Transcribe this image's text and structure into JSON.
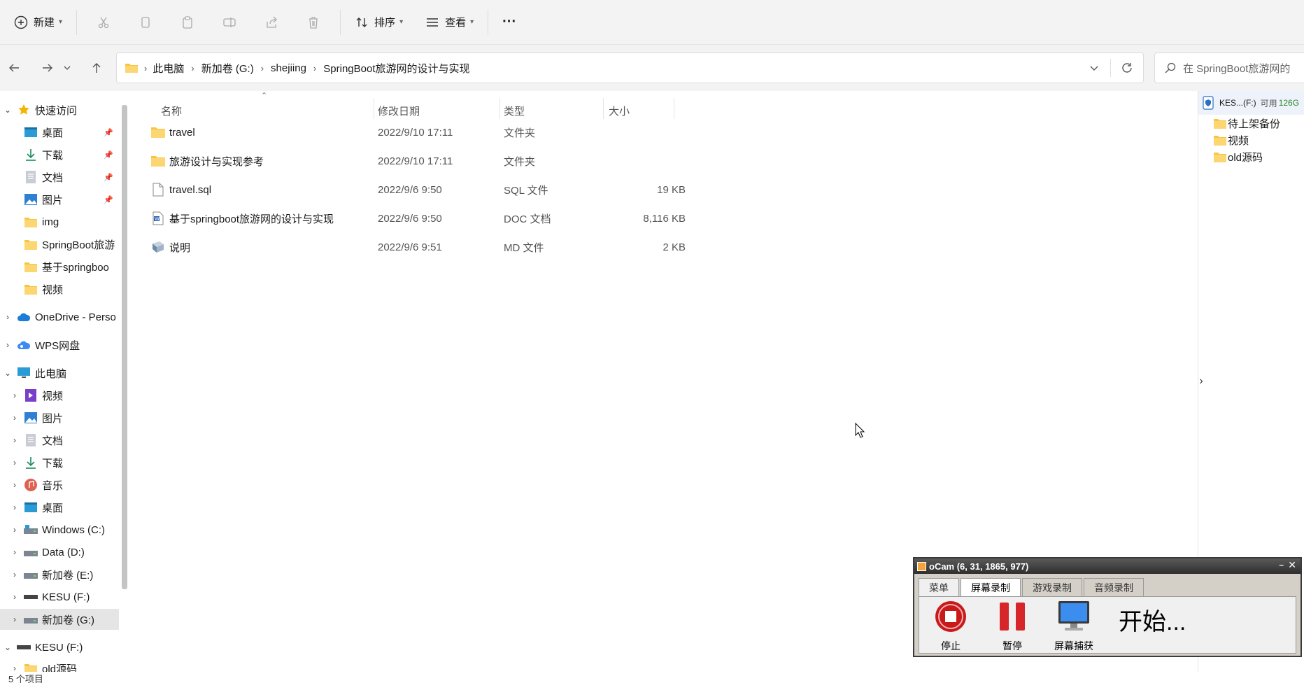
{
  "toolbar": {
    "new_label": "新建",
    "sort_label": "排序",
    "view_label": "查看",
    "more_label": "···"
  },
  "breadcrumb": [
    "此电脑",
    "新加卷 (G:)",
    "shejiing",
    "SpringBoot旅游网的设计与实现"
  ],
  "search": {
    "placeholder": "在 SpringBoot旅游网的"
  },
  "sidebar": {
    "quick_access": "快速访问",
    "quick_items": [
      {
        "label": "桌面",
        "pinned": true,
        "icon": "desktop-icon"
      },
      {
        "label": "下载",
        "pinned": true,
        "icon": "download-icon"
      },
      {
        "label": "文档",
        "pinned": true,
        "icon": "document-icon"
      },
      {
        "label": "图片",
        "pinned": true,
        "icon": "picture-icon"
      },
      {
        "label": "img",
        "pinned": false,
        "icon": "folder-icon"
      },
      {
        "label": "SpringBoot旅游",
        "pinned": false,
        "icon": "folder-icon"
      },
      {
        "label": "基于springboo",
        "pinned": false,
        "icon": "folder-icon"
      },
      {
        "label": "视频",
        "pinned": false,
        "icon": "folder-icon"
      }
    ],
    "onedrive": "OneDrive - Perso",
    "wps": "WPS网盘",
    "this_pc": "此电脑",
    "pc_items": [
      {
        "label": "视频",
        "icon": "video-icon"
      },
      {
        "label": "图片",
        "icon": "picture-icon"
      },
      {
        "label": "文档",
        "icon": "document-icon"
      },
      {
        "label": "下载",
        "icon": "download-icon"
      },
      {
        "label": "音乐",
        "icon": "music-icon"
      },
      {
        "label": "桌面",
        "icon": "desktop-icon"
      },
      {
        "label": "Windows (C:)",
        "icon": "drive-icon"
      },
      {
        "label": "Data (D:)",
        "icon": "drive-icon"
      },
      {
        "label": "新加卷 (E:)",
        "icon": "drive-icon"
      },
      {
        "label": "KESU  (F:)",
        "icon": "usb-drive-icon"
      },
      {
        "label": "新加卷 (G:)",
        "icon": "drive-icon"
      }
    ],
    "kesu": "KESU  (F:)",
    "kesu_child": "old源码"
  },
  "columns": {
    "name": "名称",
    "date": "修改日期",
    "type": "类型",
    "size": "大小"
  },
  "files": [
    {
      "name": "travel",
      "date": "2022/9/10 17:11",
      "type": "文件夹",
      "size": "",
      "icon": "folder-icon"
    },
    {
      "name": "旅游设计与实现参考",
      "date": "2022/9/10 17:11",
      "type": "文件夹",
      "size": "",
      "icon": "folder-icon"
    },
    {
      "name": "travel.sql",
      "date": "2022/9/6 9:50",
      "type": "SQL 文件",
      "size": "19 KB",
      "icon": "file-icon"
    },
    {
      "name": "基于springboot旅游网的设计与实现",
      "date": "2022/9/6 9:50",
      "type": "DOC 文档",
      "size": "8,116 KB",
      "icon": "doc-icon"
    },
    {
      "name": "说明",
      "date": "2022/9/6 9:51",
      "type": "MD 文件",
      "size": "2 KB",
      "icon": "md-icon"
    }
  ],
  "right_panel": {
    "drive_label": "KES...(F:)",
    "free_label": "可用",
    "free_value": "126G",
    "items": [
      "待上架备份",
      "视频",
      "old源码"
    ]
  },
  "status": {
    "count": "5 个项目"
  },
  "ocam": {
    "title": "oCam (6, 31, 1865, 977)",
    "tabs": [
      "菜单",
      "屏幕录制",
      "游戏录制",
      "音频录制"
    ],
    "stop": "停止",
    "pause": "暂停",
    "capture": "屏幕捕获",
    "status": "开始..."
  }
}
